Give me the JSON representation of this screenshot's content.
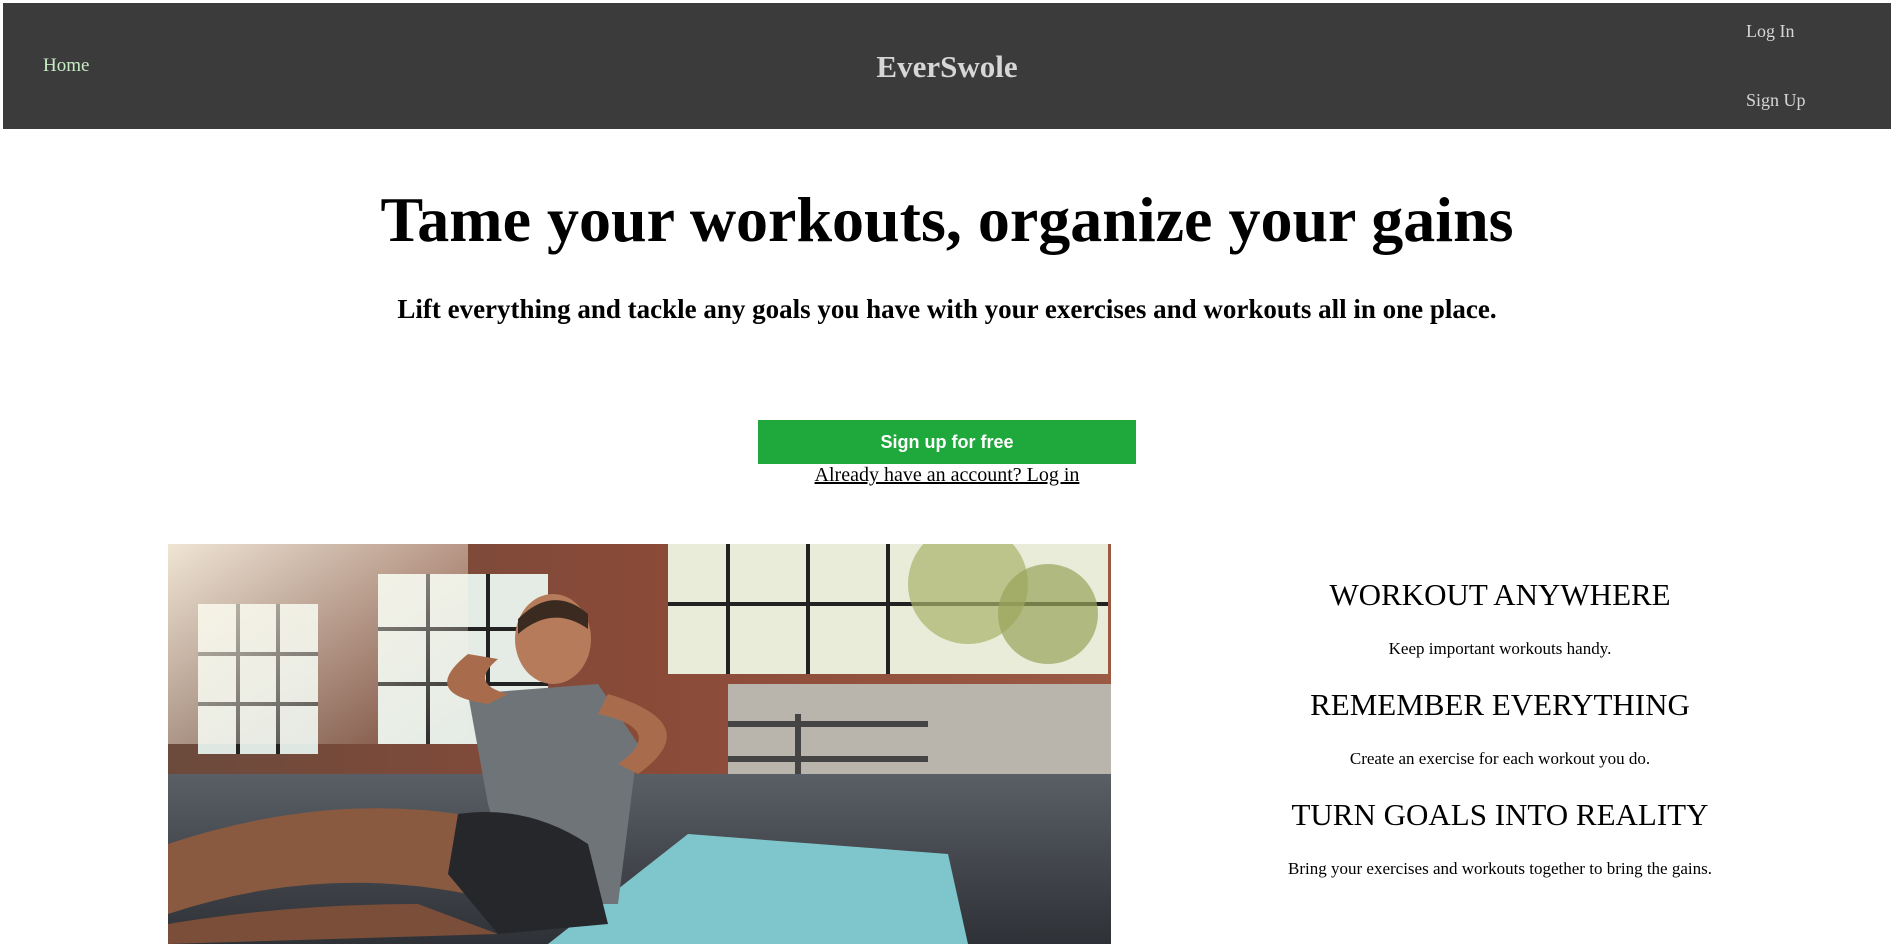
{
  "navbar": {
    "home_label": "Home",
    "brand": "EverSwole",
    "login_label": "Log In",
    "signup_label": "Sign Up"
  },
  "hero": {
    "title": "Tame your workouts, organize your gains",
    "subtitle": "Lift everything and tackle any goals you have with your exercises and workouts all in one place.",
    "cta_label": "Sign up for free",
    "login_link": "Already have an account? Log in"
  },
  "features": [
    {
      "title": "WORKOUT ANYWHERE",
      "desc": "Keep important workouts handy."
    },
    {
      "title": "REMEMBER EVERYTHING",
      "desc": "Create an exercise for each workout you do."
    },
    {
      "title": "TURN GOALS INTO REALITY",
      "desc": "Bring your exercises and workouts together to bring the gains."
    }
  ],
  "colors": {
    "navbar_bg": "#3b3b3b",
    "cta_green": "#1fa83c",
    "home_link": "#c8ecc4"
  }
}
